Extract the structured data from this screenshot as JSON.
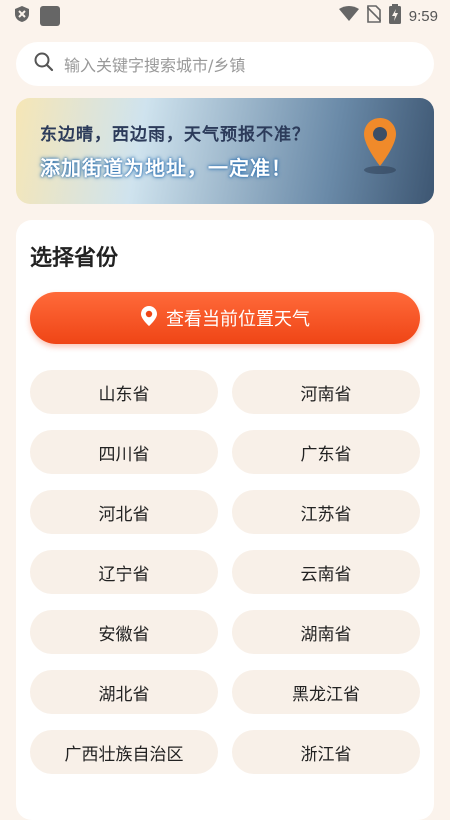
{
  "status_bar": {
    "time": "9:59",
    "icons": [
      "shield-icon",
      "app-square-icon",
      "wifi-icon",
      "no-sim-icon",
      "battery-charging-icon"
    ]
  },
  "search": {
    "placeholder": "输入关键字搜索城市/乡镇",
    "icon": "search-icon"
  },
  "banner": {
    "line1": "东边晴，西边雨，天气预报不准？",
    "line2": "添加街道为地址，一定准！",
    "icon": "location-pin-icon"
  },
  "province_section": {
    "title": "选择省份",
    "locate_button_label": "查看当前位置天气",
    "provinces": [
      "山东省",
      "河南省",
      "四川省",
      "广东省",
      "河北省",
      "江苏省",
      "辽宁省",
      "云南省",
      "安徽省",
      "湖南省",
      "湖北省",
      "黑龙江省",
      "广西壮族自治区",
      "浙江省"
    ]
  },
  "colors": {
    "background": "#fbf3ec",
    "accent": "#ef4516",
    "chip": "#f8f0e8"
  }
}
